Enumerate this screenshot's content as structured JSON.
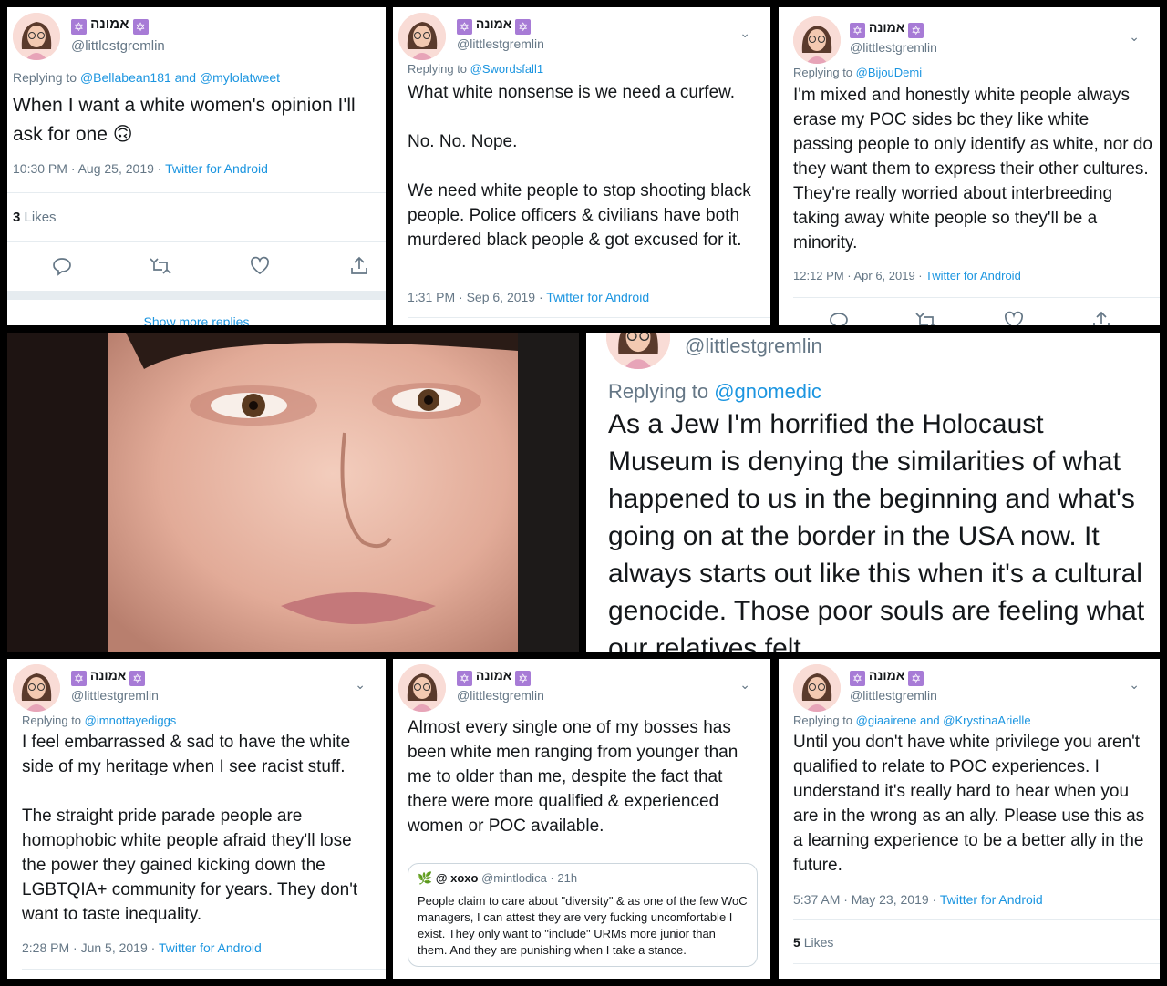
{
  "colors": {
    "link": "#1b95e0",
    "muted": "#657786",
    "text": "#14171a",
    "star": "#a77bd6"
  },
  "user": {
    "display_name": "אמונה",
    "handle": "@littlestgremlin",
    "star_icon": "star-of-david-icon"
  },
  "tweets": [
    {
      "reply_prefix": "Replying to",
      "reply_to": "@Bellabean181 and @mylolatweet",
      "text": "When I want a white women's opinion I'll ask for one 🙃",
      "time": "10:30 PM · Aug 25, 2019 ·",
      "source": "Twitter for Android",
      "likes_count": "3",
      "likes_label": "Likes",
      "show_more": "Show more replies"
    },
    {
      "reply_prefix": "Replying to",
      "reply_to": "@Swordsfall1",
      "text": "What white nonsense is we need a curfew.\n\nNo. No. Nope.\n\nWe need white people to stop shooting black people. Police officers & civilians have both murdered black people & got excused for it.",
      "time": "1:31 PM · Sep 6, 2019 ·",
      "source": "Twitter for Android"
    },
    {
      "reply_prefix": "Replying to",
      "reply_to": "@BijouDemi",
      "text": "I'm mixed and honestly white people always erase my POC sides bc they like white passing people to only identify as white, nor do they want them to express their other cultures. They're really worried about interbreeding taking away white people so they'll be a minority.",
      "time": "12:12 PM · Apr 6, 2019 ·",
      "source": "Twitter for Android"
    },
    {
      "handle": "@littlestgremlin",
      "reply_prefix": "Replying to",
      "reply_to": "@gnomedic",
      "text": "As a Jew I'm horrified the Holocaust Museum is denying the similarities of what happened to us in the beginning and what's going on at the border in the USA now. It always starts out like this when it's a cultural genocide. Those poor souls are feeling what our relatives felt"
    },
    {
      "reply_prefix": "Replying to",
      "reply_to": "@imnottayediggs",
      "text": "I feel embarrassed & sad to have the white side of my heritage when I see racist stuff.\n\nThe straight pride parade people are homophobic white people afraid they'll lose the power they gained kicking down the LGBTQIA+ community for years. They don't want to taste inequality.",
      "time": "2:28 PM · Jun 5, 2019 ·",
      "source": "Twitter for Android"
    },
    {
      "text": "Almost every single one of my bosses has been white men ranging from younger than me to older than me, despite the fact that there were more qualified & experienced women or POC available.",
      "quote": {
        "emoji": "🌿",
        "name": "@ xoxo",
        "handle": "@mintlodica · 21h",
        "text": "People claim to care about \"diversity\" & as one of the few WoC managers, I can attest they are very fucking uncomfortable I exist. They only want to \"include\" URMs more junior than them. And they are punishing when I take a stance."
      }
    },
    {
      "reply_prefix": "Replying to",
      "reply_to": "@giaairene and @KrystinaArielle",
      "text": "Until you don't have white privilege you aren't qualified to relate to POC experiences. I understand it's really hard to hear when you are in the wrong as an ally. Please use this as a learning experience to be a better ally in the future.",
      "time": "5:37 AM · May 23, 2019 ·",
      "source": "Twitter for Android",
      "likes_count": "5",
      "likes_label": "Likes"
    }
  ]
}
